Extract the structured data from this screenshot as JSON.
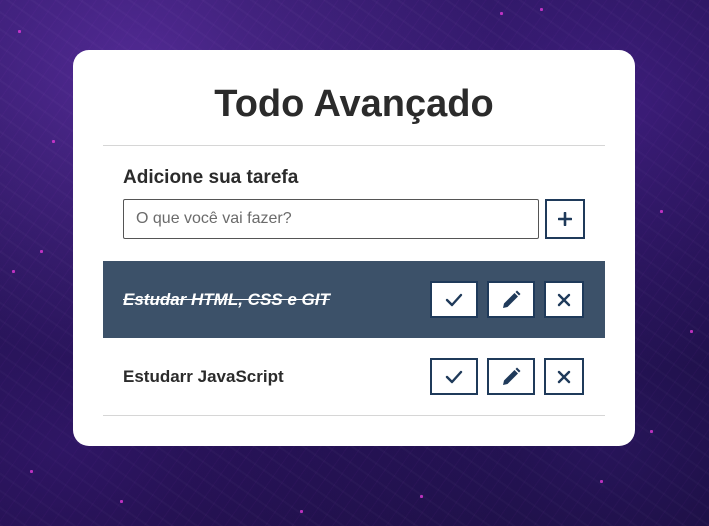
{
  "app": {
    "title": "Todo Avançado"
  },
  "form": {
    "label": "Adicione sua tarefa",
    "input_value": "",
    "input_placeholder": "O que você vai fazer?",
    "add_button_icon": "plus-icon"
  },
  "todos": [
    {
      "title": "Estudar HTML, CSS e GIT",
      "done": true,
      "actions": [
        "check-icon",
        "pencil-icon",
        "close-icon"
      ]
    },
    {
      "title": "Estudarr JavaScript",
      "done": false,
      "actions": [
        "check-icon",
        "pencil-icon",
        "close-icon"
      ]
    }
  ],
  "colors": {
    "card": "#ffffff",
    "done_row": "#3c5169",
    "button_border": "#1f3a5a",
    "text": "#2b2b2b"
  }
}
